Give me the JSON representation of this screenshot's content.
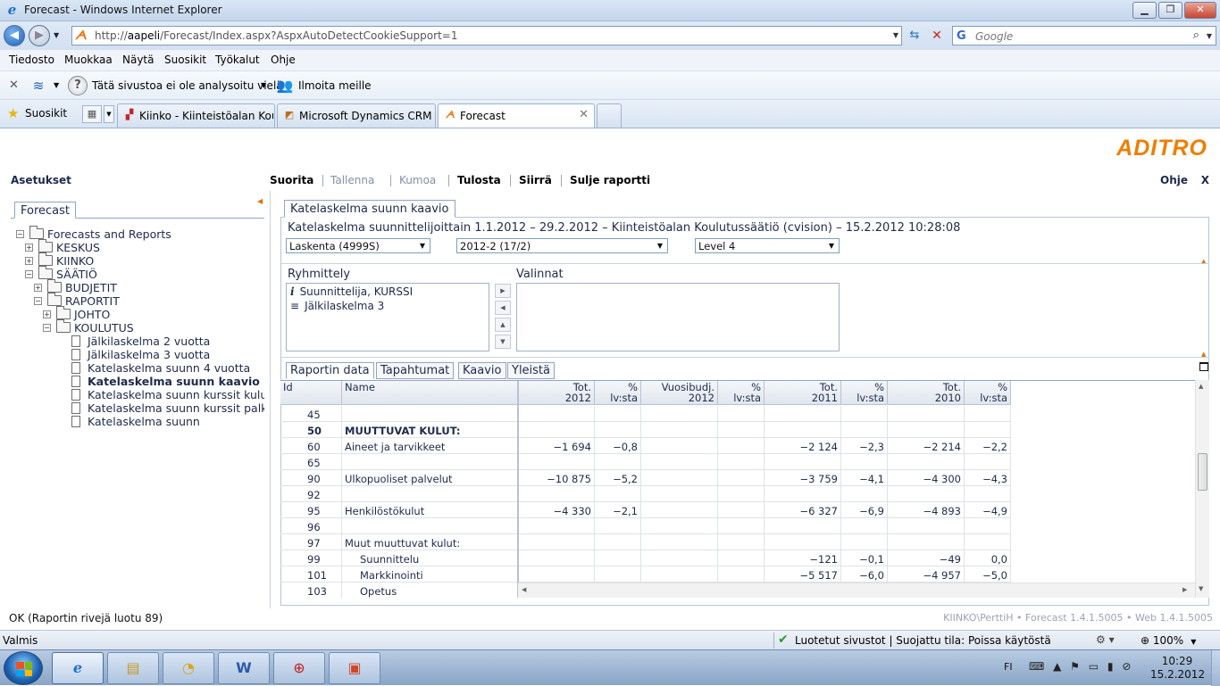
{
  "window": {
    "title": "Forecast - Windows Internet Explorer"
  },
  "address": {
    "url_prefix": "http://",
    "url_host": "aapeli",
    "url_rest": "/Forecast/Index.aspx?AspxAutoDetectCookieSupport=1",
    "search_placeholder": "Google"
  },
  "menu": [
    "Tiedosto",
    "Muokkaa",
    "Näytä",
    "Suosikit",
    "Työkalut",
    "Ohje"
  ],
  "commandbar": {
    "analysis_text": "Tätä sivustoa ei ole analysoitu vielä",
    "report_text": "Ilmoita meille"
  },
  "favorites": {
    "label": "Suosikit"
  },
  "tabs": [
    {
      "label": "Kiinko - Kiinteistöalan Kou...",
      "active": false
    },
    {
      "label": "Microsoft Dynamics CRM",
      "active": false
    },
    {
      "label": "Forecast",
      "active": true
    }
  ],
  "app": {
    "logo": "ADITRO",
    "settings_label": "Asetukset",
    "toolbar": [
      {
        "label": "Suorita",
        "enabled": true
      },
      {
        "label": "Tallenna",
        "enabled": false
      },
      {
        "label": "Kumoa",
        "enabled": false
      },
      {
        "label": "Tulosta",
        "enabled": true
      },
      {
        "label": "Siirrä",
        "enabled": true
      },
      {
        "label": "Sulje raportti",
        "enabled": true
      }
    ],
    "help_label": "Ohje",
    "close_label": "X",
    "left_tab": "Forecast",
    "tree": [
      {
        "label": "Forecasts and Reports",
        "level": 0,
        "type": "folder",
        "expander": "−"
      },
      {
        "label": "KESKUS",
        "level": 1,
        "type": "folder",
        "expander": "+"
      },
      {
        "label": "KIINKO",
        "level": 1,
        "type": "folder",
        "expander": "+"
      },
      {
        "label": "SÄÄTIÖ",
        "level": 1,
        "type": "folder",
        "expander": "−"
      },
      {
        "label": "BUDJETIT",
        "level": 2,
        "type": "folder",
        "expander": "+"
      },
      {
        "label": "RAPORTIT",
        "level": 2,
        "type": "folder",
        "expander": "−"
      },
      {
        "label": "JOHTO",
        "level": 3,
        "type": "folder",
        "expander": "+"
      },
      {
        "label": "KOULUTUS",
        "level": 3,
        "type": "folder",
        "expander": "−"
      },
      {
        "label": "Jälkilaskelma 2 vuotta",
        "level": 4,
        "type": "doc"
      },
      {
        "label": "Jälkilaskelma 3 vuotta",
        "level": 4,
        "type": "doc"
      },
      {
        "label": "Katelaskelma suunn 4 vuotta",
        "level": 4,
        "type": "doc"
      },
      {
        "label": "Katelaskelma suunn kaavio",
        "level": 4,
        "type": "doc",
        "selected": true
      },
      {
        "label": "Katelaskelma suunn kurssit kuluryhmittäin",
        "level": 4,
        "type": "doc"
      },
      {
        "label": "Katelaskelma suunn kurssit palkkat",
        "level": 4,
        "type": "doc"
      },
      {
        "label": "Katelaskelma suunn",
        "level": 4,
        "type": "doc"
      }
    ],
    "report_tab": "Katelaskelma suunn kaavio",
    "report_title": "Katelaskelma suunnittelijoittain 1.1.2012 – 29.2.2012 – Kiinteistöalan Koulutussäätiö (cvision) – 15.2.2012 10:28:08",
    "selects": [
      {
        "value": "Laskenta (4999S)"
      },
      {
        "value": "2012-2 (17/2)"
      },
      {
        "value": "Level 4"
      }
    ],
    "grouping_label": "Ryhmittely",
    "selections_label": "Valinnat",
    "grouping_items": [
      {
        "icon": "i",
        "label": "Suunnittelija, KURSSI"
      },
      {
        "icon": "≡",
        "label": "Jälkilaskelma 3"
      }
    ],
    "subtabs": [
      {
        "label": "Raportin data",
        "active": true
      },
      {
        "label": "Tapahtumat",
        "active": false
      },
      {
        "label": "Kaavio",
        "active": false
      },
      {
        "label": "Yleistä",
        "active": false
      }
    ],
    "grid": {
      "columns": [
        {
          "label": "Id",
          "label2": ""
        },
        {
          "label": "Name",
          "label2": ""
        },
        {
          "label": "Tot.",
          "label2": "2012"
        },
        {
          "label": "%",
          "label2": "lv:sta"
        },
        {
          "label": "Vuosibudj.",
          "label2": "2012"
        },
        {
          "label": "%",
          "label2": "lv:sta"
        },
        {
          "label": "Tot.",
          "label2": "2011"
        },
        {
          "label": "%",
          "label2": "lv:sta"
        },
        {
          "label": "Tot.",
          "label2": "2010"
        },
        {
          "label": "%",
          "label2": "lv:sta"
        }
      ],
      "rows": [
        {
          "id": "45",
          "name": "",
          "v": [
            "",
            "",
            "",
            "",
            "",
            "",
            "",
            ""
          ]
        },
        {
          "id": "50",
          "name": "MUUTTUVAT KULUT:",
          "bold": true,
          "v": [
            "",
            "",
            "",
            "",
            "",
            "",
            "",
            ""
          ]
        },
        {
          "id": "60",
          "name": "Aineet ja tarvikkeet",
          "v": [
            "−1 694",
            "−0,8",
            "",
            "",
            "−2 124",
            "−2,3",
            "−2 214",
            "−2,2"
          ]
        },
        {
          "id": "65",
          "name": "",
          "v": [
            "",
            "",
            "",
            "",
            "",
            "",
            "",
            ""
          ]
        },
        {
          "id": "90",
          "name": "Ulkopuoliset palvelut",
          "v": [
            "−10 875",
            "−5,2",
            "",
            "",
            "−3 759",
            "−4,1",
            "−4 300",
            "−4,3"
          ]
        },
        {
          "id": "92",
          "name": "",
          "v": [
            "",
            "",
            "",
            "",
            "",
            "",
            "",
            ""
          ]
        },
        {
          "id": "95",
          "name": "Henkilöstökulut",
          "v": [
            "−4 330",
            "−2,1",
            "",
            "",
            "−6 327",
            "−6,9",
            "−4 893",
            "−4,9"
          ]
        },
        {
          "id": "96",
          "name": "",
          "v": [
            "",
            "",
            "",
            "",
            "",
            "",
            "",
            ""
          ]
        },
        {
          "id": "97",
          "name": "Muut muuttuvat kulut:",
          "v": [
            "",
            "",
            "",
            "",
            "",
            "",
            "",
            ""
          ]
        },
        {
          "id": "99",
          "name": "Suunnittelu",
          "indent": true,
          "v": [
            "",
            "",
            "",
            "",
            "−121",
            "−0,1",
            "−49",
            "0,0"
          ]
        },
        {
          "id": "101",
          "name": "Markkinointi",
          "indent": true,
          "v": [
            "",
            "",
            "",
            "",
            "−5 517",
            "−6,0",
            "−4 957",
            "−5,0"
          ]
        },
        {
          "id": "103",
          "name": "Opetus",
          "indent": true,
          "v": [
            "",
            "",
            "",
            "",
            "",
            "",
            "",
            ""
          ]
        }
      ]
    },
    "status_text": "OK (Raportin rivejä luotu 89)",
    "version_text": "KIINKO\\PerttiH • Forecast 1.4.1.5005 • Web 1.4.1.5005"
  },
  "statusbar": {
    "ready": "Valmis",
    "security": "Luotetut sivustot | Suojattu tila: Poissa käytöstä",
    "zoom": "100%"
  },
  "taskbar": {
    "lang": "FI",
    "time": "10:29",
    "date": "15.2.2012"
  },
  "colors": {
    "accent": "#f07d00",
    "text": "#1e2a4a"
  }
}
